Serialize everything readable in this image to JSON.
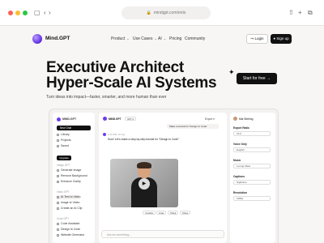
{
  "browser": {
    "url": "mindgpt.com/ents",
    "colors": {
      "close": "#ff5f57",
      "minimize": "#febc2e",
      "maximize": "#28c840"
    }
  },
  "nav": {
    "brand": "Mind.GPT",
    "links": [
      "Product",
      "Use Cases",
      "AI",
      "Pricing",
      "Community"
    ],
    "login": "Login",
    "signup": "Sign up"
  },
  "hero": {
    "title_line1": "Executive Architect",
    "title_line2": "Hyper-Scale AI Systems",
    "subtitle": "Turn ideas into impact—faster, smarter, and more human than ever",
    "cta": "Start for free →"
  },
  "app": {
    "sidebar": {
      "brand": "MIND.GPT",
      "new_chat": "New Chat",
      "items": [
        "Library",
        "Projects",
        "Saved"
      ],
      "upgrade": "Upgrade",
      "groups": [
        {
          "header": "Image GPT",
          "items": [
            "Generate Image",
            "Remove Background",
            "Enhance Clarity"
          ]
        },
        {
          "header": "Video GPT",
          "items": [
            "AI Text to Video",
            "Image to Video",
            "Create an AI Clip"
          ]
        },
        {
          "header": "Code GPT",
          "items": [
            "Code Assistant",
            "Design to Code",
            "Website Generator"
          ]
        }
      ]
    },
    "chat": {
      "assistant": "MIND.GPT",
      "model_chip": "GPT-4",
      "export_label": "Export ▾",
      "user_prompt": "Make a tutorial for 'Design to Code'",
      "time": "2:10 PM, 10 Apr",
      "reply": "Sure! Let's make a step-by-step tutorial for \"Design to Code\"",
      "action_chips": [
        "Youtube",
        "Insta",
        "Tiktok",
        "Share"
      ],
      "input_placeholder": "Ask me something..."
    },
    "settings": {
      "user": "Mia Sterling",
      "sections": [
        {
          "label": "Export Ratio",
          "value": "16:9"
        },
        {
          "label": "Voice Only",
          "value": "English"
        },
        {
          "label": "Music",
          "value": "Lounge Beat"
        },
        {
          "label": "Captions",
          "value": "Nighttime"
        },
        {
          "label": "Resolution",
          "value": "1080p"
        }
      ]
    }
  }
}
